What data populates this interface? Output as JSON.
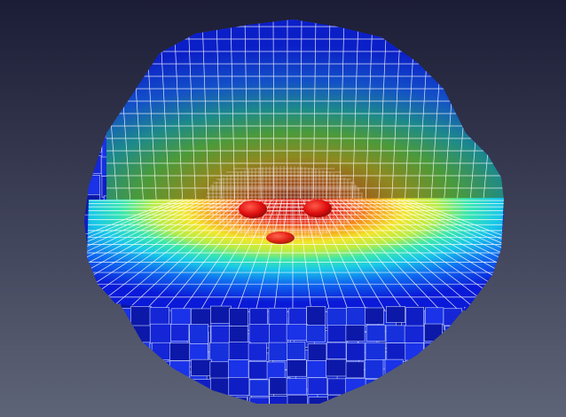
{
  "viewer": {
    "background_top_color": "#1b1c35",
    "background_bottom_color": "#5e6478"
  },
  "rendering": {
    "subject": "octree-refined-voxel-mesh",
    "grid_line_color": "#ffffff",
    "colormap": [
      "#0a1ad8",
      "#0f6bf0",
      "#19c8e8",
      "#39e6b0",
      "#b8ec45",
      "#f2e62a",
      "#f79a1c",
      "#e8321b",
      "#c60e0e"
    ],
    "marker_color": "#e01010",
    "marker_count": 3
  }
}
